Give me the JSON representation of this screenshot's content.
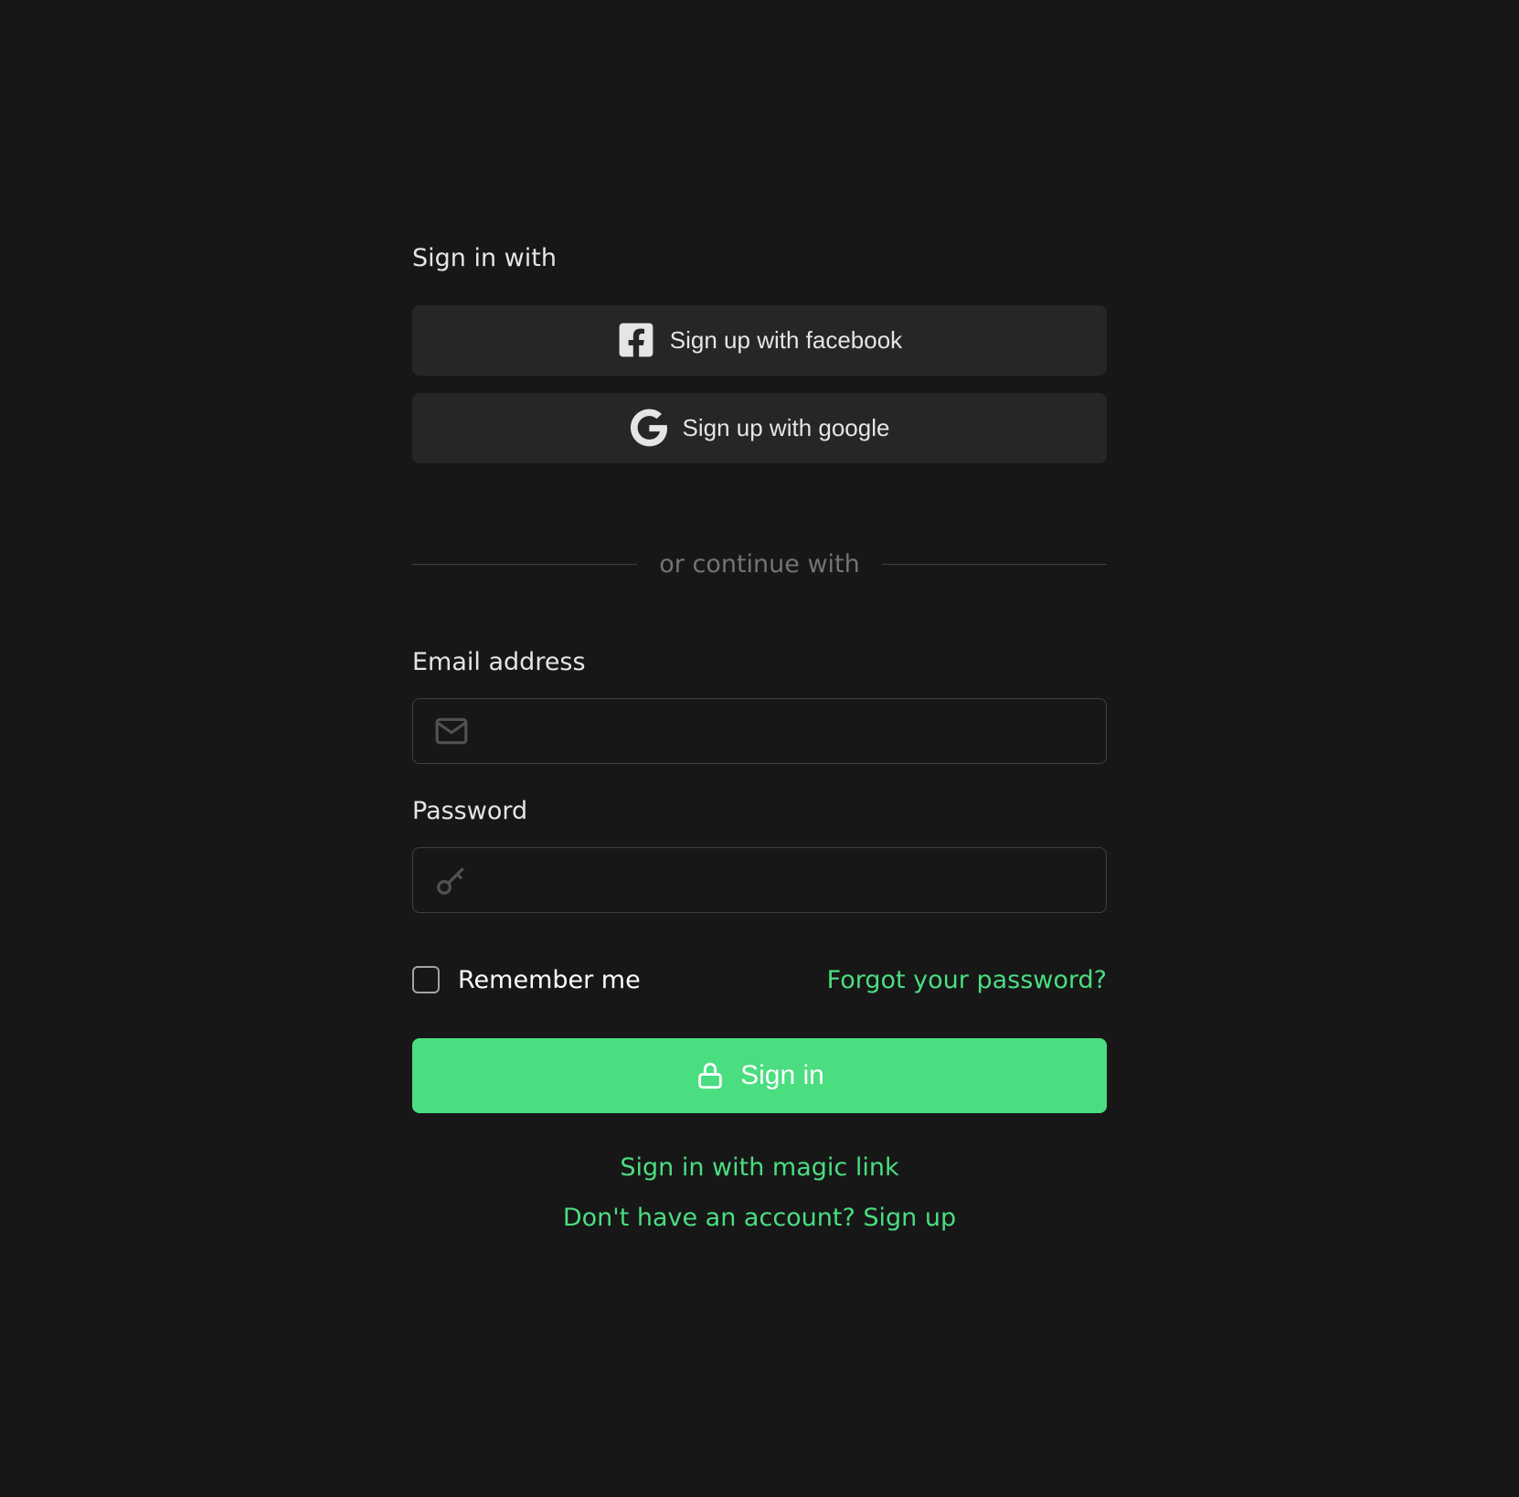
{
  "heading": "Sign in with",
  "social": {
    "facebook_label": "Sign up with facebook",
    "google_label": "Sign up with google"
  },
  "divider_text": "or continue with",
  "form": {
    "email_label": "Email address",
    "password_label": "Password",
    "remember_label": "Remember me"
  },
  "links": {
    "forgot_password": "Forgot your password?",
    "magic_link": "Sign in with magic link",
    "signup": "Don't have an account? Sign up"
  },
  "buttons": {
    "signin": "Sign in"
  }
}
